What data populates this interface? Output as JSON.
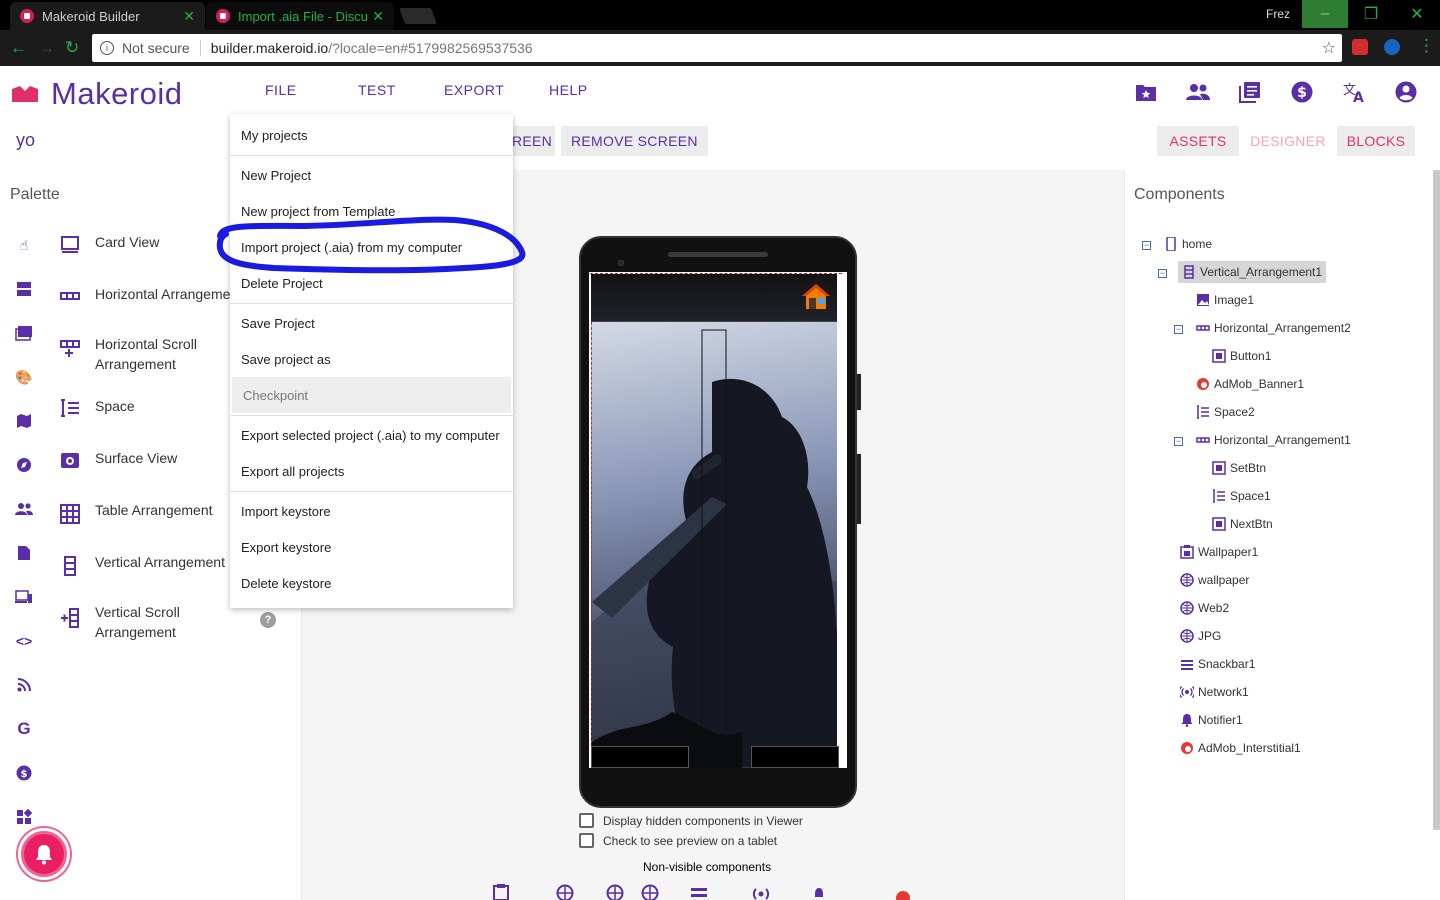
{
  "browser": {
    "tabs": [
      {
        "title": "Makeroid Builder",
        "close": "✕"
      },
      {
        "title": "Import .aia File - Discuss",
        "close": "✕"
      }
    ],
    "user": "Frez",
    "url_secure_label": "Not secure",
    "url_host": "builder.makeroid.io",
    "url_path": "/?locale=en#5179982569537536",
    "window_controls": [
      "–",
      "❐",
      "✕"
    ]
  },
  "app": {
    "logo": "Makeroid",
    "menu": [
      "FILE",
      "TEST",
      "EXPORT",
      "HELP"
    ],
    "header_icons": [
      "folder-star-icon",
      "people-icon",
      "library-books-icon",
      "dollar-icon",
      "translate-icon",
      "account-icon"
    ],
    "project_name": "yo",
    "toolbar": {
      "add_screen_partial": "REEN",
      "remove_screen": "REMOVE SCREEN",
      "assets": "ASSETS",
      "designer": "DESIGNER",
      "blocks": "BLOCKS"
    },
    "accent_color": "#5a2ea6",
    "pink_color": "#e0306a"
  },
  "palette": {
    "title": "Palette",
    "rail_icons": [
      "touch-icon",
      "layout-icon",
      "media-icon",
      "drawing-icon",
      "maps-icon",
      "sensors-icon",
      "social-icon",
      "storage-icon",
      "connectivity-icon",
      "code-icon",
      "rss-icon",
      "google-icon",
      "money-icon",
      "extension-icon"
    ],
    "items": [
      {
        "label": "Card View",
        "icon": "card-view-icon"
      },
      {
        "label": "Horizontal Arrangeme",
        "icon": "horizontal-arrangement-icon"
      },
      {
        "label": "Horizontal Scroll Arrangement",
        "icon": "horizontal-scroll-icon"
      },
      {
        "label": "Space",
        "icon": "space-icon"
      },
      {
        "label": "Surface View",
        "icon": "surface-view-icon"
      },
      {
        "label": "Table Arrangement",
        "icon": "table-icon"
      },
      {
        "label": "Vertical Arrangement",
        "icon": "vertical-arrangement-icon"
      },
      {
        "label": "Vertical Scroll Arrangement",
        "icon": "vertical-scroll-icon"
      }
    ],
    "help": "?"
  },
  "file_menu": {
    "items": [
      {
        "label": "My projects",
        "disabled": false
      },
      {
        "label": "New Project",
        "disabled": false
      },
      {
        "label": "New project from Template",
        "disabled": false
      },
      {
        "label": "Import project (.aia) from my computer",
        "disabled": false,
        "circled": true
      },
      {
        "label": "Delete Project",
        "disabled": false
      },
      {
        "label": "Save Project",
        "disabled": false
      },
      {
        "label": "Save project as",
        "disabled": false
      },
      {
        "label": "Checkpoint",
        "disabled": true
      },
      {
        "label": "Export selected project (.aia) to my computer",
        "disabled": false
      },
      {
        "label": "Export all projects",
        "disabled": false
      },
      {
        "label": "Import keystore",
        "disabled": false
      },
      {
        "label": "Export keystore",
        "disabled": false
      },
      {
        "label": "Delete keystore",
        "disabled": false
      }
    ]
  },
  "viewer": {
    "checkboxes": [
      {
        "label": "Display hidden components in Viewer",
        "checked": false
      },
      {
        "label": "Check to see preview on a tablet",
        "checked": false
      }
    ],
    "nonvisible_title": "Non-visible components",
    "nonvisible_icons": [
      "wallpaper-icon",
      "web-icon",
      "web-icon",
      "web-icon",
      "snackbar-icon",
      "network-icon",
      "notifier-icon",
      "admob-icon"
    ]
  },
  "components": {
    "title": "Components",
    "tree": [
      {
        "label": "home",
        "icon": "phone-icon",
        "level": 0,
        "toggle": "−"
      },
      {
        "label": "Vertical_Arrangement1",
        "icon": "vertical-arrangement-icon",
        "level": 1,
        "toggle": "−",
        "selected": true
      },
      {
        "label": "Image1",
        "icon": "image-icon",
        "level": 2
      },
      {
        "label": "Horizontal_Arrangement2",
        "icon": "horizontal-arrangement-icon",
        "level": 2,
        "toggle": "−"
      },
      {
        "label": "Button1",
        "icon": "button-icon",
        "level": 3
      },
      {
        "label": "AdMob_Banner1",
        "icon": "admob-icon",
        "level": 2
      },
      {
        "label": "Space2",
        "icon": "space-icon",
        "level": 2
      },
      {
        "label": "Horizontal_Arrangement1",
        "icon": "horizontal-arrangement-icon",
        "level": 2,
        "toggle": "−"
      },
      {
        "label": "SetBtn",
        "icon": "button-icon",
        "level": 3
      },
      {
        "label": "Space1",
        "icon": "space-icon",
        "level": 3
      },
      {
        "label": "NextBtn",
        "icon": "button-icon",
        "level": 3
      },
      {
        "label": "Wallpaper1",
        "icon": "wallpaper-icon",
        "level": 1
      },
      {
        "label": "wallpaper",
        "icon": "web-icon",
        "level": 1
      },
      {
        "label": "Web2",
        "icon": "web-icon",
        "level": 1
      },
      {
        "label": "JPG",
        "icon": "web-icon",
        "level": 1
      },
      {
        "label": "Snackbar1",
        "icon": "snackbar-icon",
        "level": 1
      },
      {
        "label": "Network1",
        "icon": "network-icon",
        "level": 1
      },
      {
        "label": "Notifier1",
        "icon": "notifier-icon",
        "level": 1
      },
      {
        "label": "AdMob_Interstitial1",
        "icon": "admob-icon",
        "level": 1
      }
    ]
  }
}
